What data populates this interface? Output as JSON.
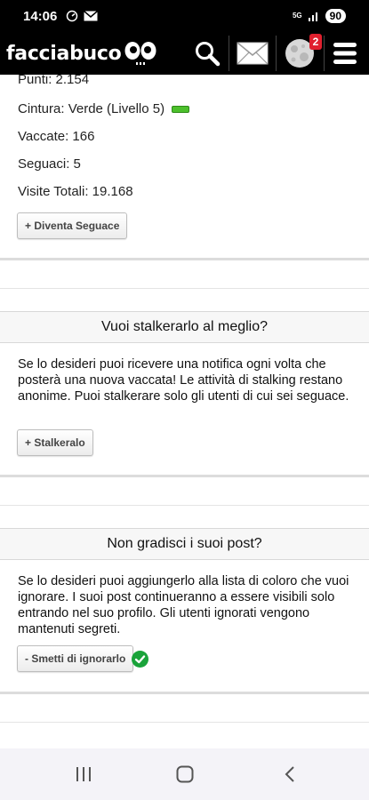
{
  "status_bar": {
    "time": "14:06",
    "network": "5G",
    "battery": "90"
  },
  "header": {
    "logo_text": "facciabuco",
    "notification_count": "2",
    "icons": [
      "search-icon",
      "mail-icon",
      "moon-avatar-icon",
      "hamburger-menu-icon"
    ]
  },
  "profile_stats": {
    "points": "Punti: 2.154",
    "belt": "Cintura: Verde (Livello 5)",
    "belt_color": "#4cc02c",
    "posts": "Vaccate: 166",
    "followers": "Seguaci: 5",
    "visits": "Visite Totali: 19.168",
    "follow_button": "+ Diventa Seguace"
  },
  "stalk_section": {
    "title": "Vuoi stalkerarlo al meglio?",
    "text": "Se lo desideri puoi ricevere una notifica ogni volta che posterà una nuova vaccata! Le attività di stalking restano anonime. Puoi stalkerare solo gli utenti di cui sei seguace.",
    "button": "+ Stalkeralo"
  },
  "ignore_section": {
    "title": "Non gradisci i suoi post?",
    "text": "Se lo desideri puoi aggiungerlo alla lista di coloro che vuoi ignorare. I suoi post continueranno a essere visibili solo entrando nel suo profilo. Gli utenti ignorati vengono mantenuti segreti.",
    "button": "- Smetti di ignorarlo",
    "status_icon": "check-circle-icon",
    "status_color": "#1aa33a"
  },
  "nav_bar": {
    "icons": [
      "recent-apps-icon",
      "home-icon",
      "back-icon"
    ]
  }
}
